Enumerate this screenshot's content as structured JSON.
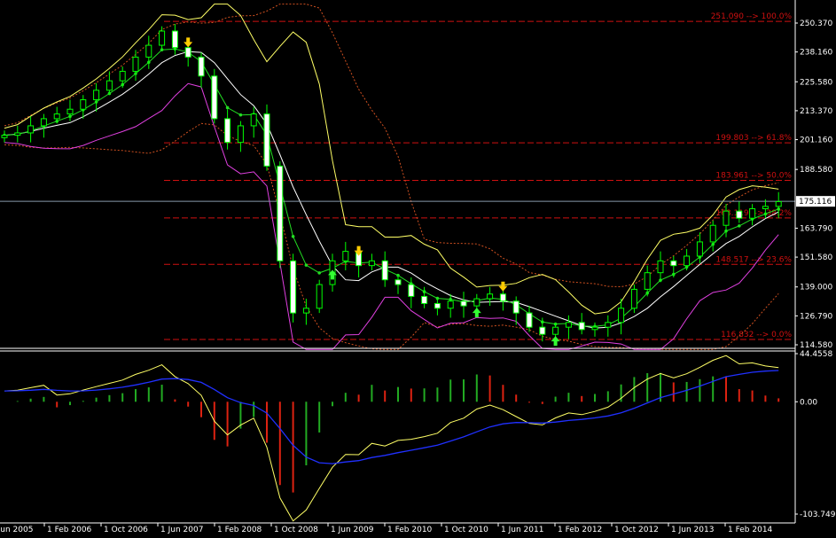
{
  "chart_data": {
    "type": "candlestick",
    "title": "",
    "price_axis": {
      "range": [
        114.58,
        250.37
      ],
      "ticks": [
        "250.370",
        "238.160",
        "225.580",
        "213.370",
        "201.160",
        "188.580",
        "175.116",
        "163.790",
        "151.580",
        "139.000",
        "126.790",
        "114.580"
      ],
      "current_price": "175.116"
    },
    "time_axis": {
      "ticks": [
        "1 Jun 2005",
        "1 Feb 2006",
        "1 Oct 2006",
        "1 Jun 2007",
        "1 Feb 2008",
        "1 Oct 2008",
        "1 Jun 2009",
        "1 Feb 2010",
        "1 Oct 2010",
        "1 Jun 2011",
        "1 Feb 2012",
        "1 Oct 2012",
        "1 Jun 2013",
        "1 Feb 2014"
      ]
    },
    "closes": [
      203,
      204,
      207,
      210,
      212,
      214,
      218,
      222,
      226,
      230,
      236,
      241,
      247,
      240,
      236,
      228,
      210,
      200,
      207,
      212,
      190,
      150,
      128,
      130,
      140,
      150,
      154,
      148,
      150,
      142,
      140,
      135,
      132,
      130,
      133,
      131,
      134,
      136,
      133,
      128,
      122,
      119,
      122,
      124,
      121,
      122,
      124,
      130,
      138,
      145,
      150,
      148,
      152,
      158,
      165,
      171,
      168,
      172,
      173,
      175
    ],
    "fibonacci": [
      {
        "price": 251.09,
        "label": "251.090 --> 100.0%"
      },
      {
        "price": 199.803,
        "label": "199.803 --> 61.8%"
      },
      {
        "price": 183.961,
        "label": "183.961 --> 50.0%"
      },
      {
        "price": 168.119,
        "label": "168.119 --> 38.2%"
      },
      {
        "price": 148.517,
        "label": "148.517 --> 23.6%"
      },
      {
        "price": 116.832,
        "label": "116.832 --> 0.0%"
      }
    ],
    "signals": [
      {
        "index": 14,
        "type": "sell"
      },
      {
        "index": 27,
        "type": "sell"
      },
      {
        "index": 38,
        "type": "sell"
      },
      {
        "index": 25,
        "type": "buy"
      },
      {
        "index": 36,
        "type": "buy"
      },
      {
        "index": 42,
        "type": "buy"
      }
    ],
    "oscillator": {
      "range": [
        -103.7492,
        44.4558
      ],
      "ticks": [
        "44.4558",
        "0.00",
        "-103.7492"
      ]
    },
    "colors": {
      "bull": "#00ff00",
      "bear_fill": "#ffffff",
      "fib": "#d01010",
      "band_upper": "#ffff66",
      "band_lower": "#e040e0",
      "ma": "#ffffff",
      "ma_dots": "#22dd22",
      "envelope": "#d05020",
      "sar": "#ffcc00",
      "osc_fast": "#ffff66",
      "osc_slow": "#2030ff",
      "hist_up": "#22aa22",
      "hist_down": "#dd2211"
    }
  }
}
